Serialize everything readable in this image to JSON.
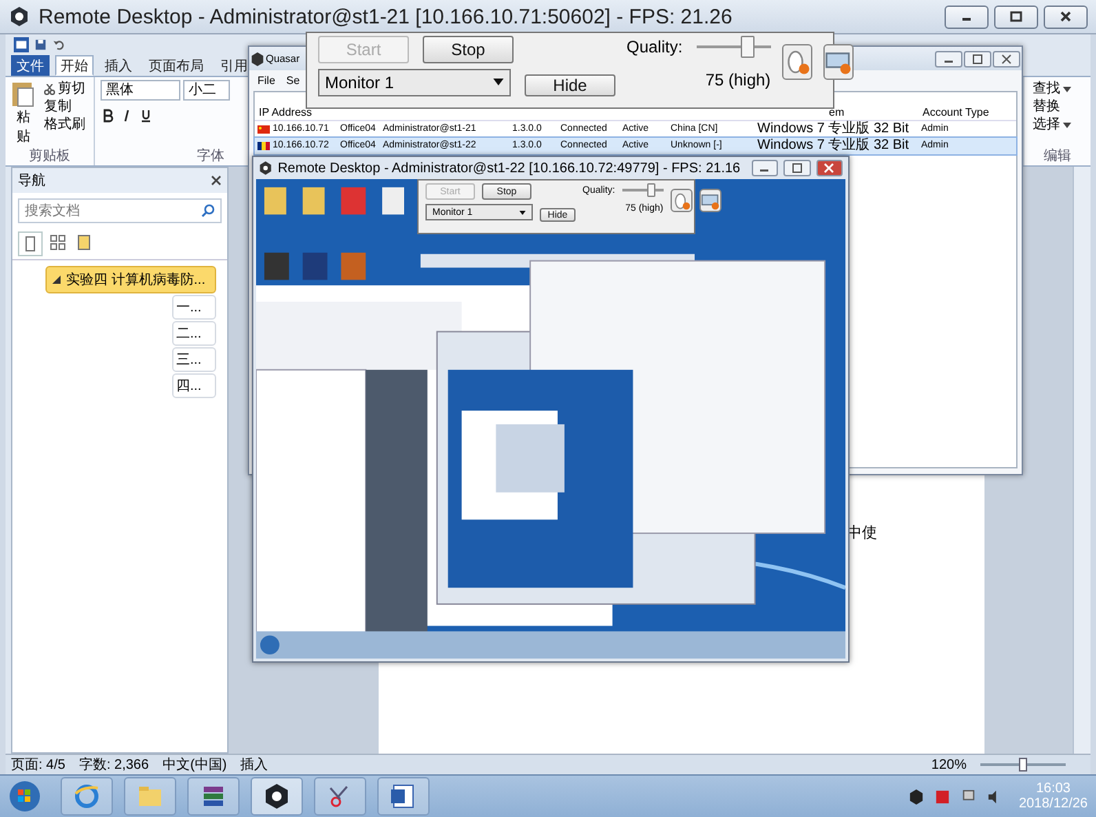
{
  "window": {
    "title": "Remote Desktop - Administrator@st1-21 [10.166.10.71:50602] - FPS: 21.26"
  },
  "control_panel": {
    "buttons": [
      {
        "label": "Start",
        "disabled": true
      },
      {
        "label": "Stop",
        "disabled": false
      }
    ],
    "quality_label": "Quality:",
    "quality": {
      "level": 0.7
    },
    "quality_reading": "75 (high)",
    "monitor": "Monitor 1",
    "hide": "Hide"
  },
  "word": {
    "tabs": [
      {
        "label": "文件",
        "selected": false,
        "kind": "file"
      },
      {
        "label": "开始",
        "selected": true,
        "kind": "tab"
      },
      {
        "label": "插入",
        "selected": false,
        "kind": "tab"
      },
      {
        "label": "页面布局",
        "selected": false,
        "kind": "tab"
      },
      {
        "label": "引用",
        "selected": false,
        "kind": "tab"
      }
    ],
    "clipboard": {
      "paste": "粘贴",
      "cut": "剪切",
      "copy": "复制",
      "format_painter": "格式刷",
      "group": "剪贴板"
    },
    "font": {
      "name": "黑体",
      "size": "小二",
      "group": "字体"
    },
    "editing": {
      "find": "查找",
      "replace": "替换",
      "select": "选择",
      "group": "编辑"
    },
    "navigation": {
      "title": "导航",
      "search_placeholder": "搜索文档",
      "headings": [
        {
          "label": "实验四  计算机病毒防...",
          "expanded": true,
          "children": [
            {
              "label": "一..."
            },
            {
              "label": "二..."
            },
            {
              "label": "三..."
            },
            {
              "label": "四..."
            }
          ]
        }
      ]
    },
    "document_text": "中使",
    "status_bar": {
      "page": "页面: 4/5",
      "words": "字数: 2,366",
      "language": "中文(中国)",
      "mode": "插入",
      "zoom": "120%",
      "zoom_slider": {
        "level": 0.5
      }
    }
  },
  "quasar": {
    "title": "Quasar",
    "menu": [
      "File",
      "Se"
    ],
    "columns": [
      "IP Address",
      "",
      "",
      "",
      "",
      "",
      "",
      "em",
      "Account Type"
    ],
    "rows": [
      {
        "kind": "china",
        "selected": false,
        "cells": [
          "10.166.10.71",
          "Office04",
          "Administrator@st1-21",
          "1.3.0.0",
          "Connected",
          "Active",
          "China [CN]",
          "Windows 7 专业版 32 Bit",
          "Admin"
        ]
      },
      {
        "kind": "unknown",
        "selected": true,
        "cells": [
          "10.166.10.72",
          "Office04",
          "Administrator@st1-22",
          "1.3.0.0",
          "Connected",
          "Active",
          "Unknown [-]",
          "Windows 7 专业版 32 Bit",
          "Admin"
        ]
      }
    ]
  },
  "remote_window": {
    "title": "Remote Desktop - Administrator@st1-22 [10.166.10.72:49779] - FPS: 21.16",
    "control_panel": {
      "buttons": [
        {
          "label": "Start",
          "disabled": true
        },
        {
          "label": "Stop",
          "disabled": false
        }
      ],
      "quality_label": "Quality:",
      "quality": {
        "level": 0.7
      },
      "quality_reading": "75 (high)",
      "monitor": "Monitor 1",
      "hide": "Hide"
    }
  },
  "taskbar": {
    "time": "16:03",
    "date": "2018/12/26"
  }
}
